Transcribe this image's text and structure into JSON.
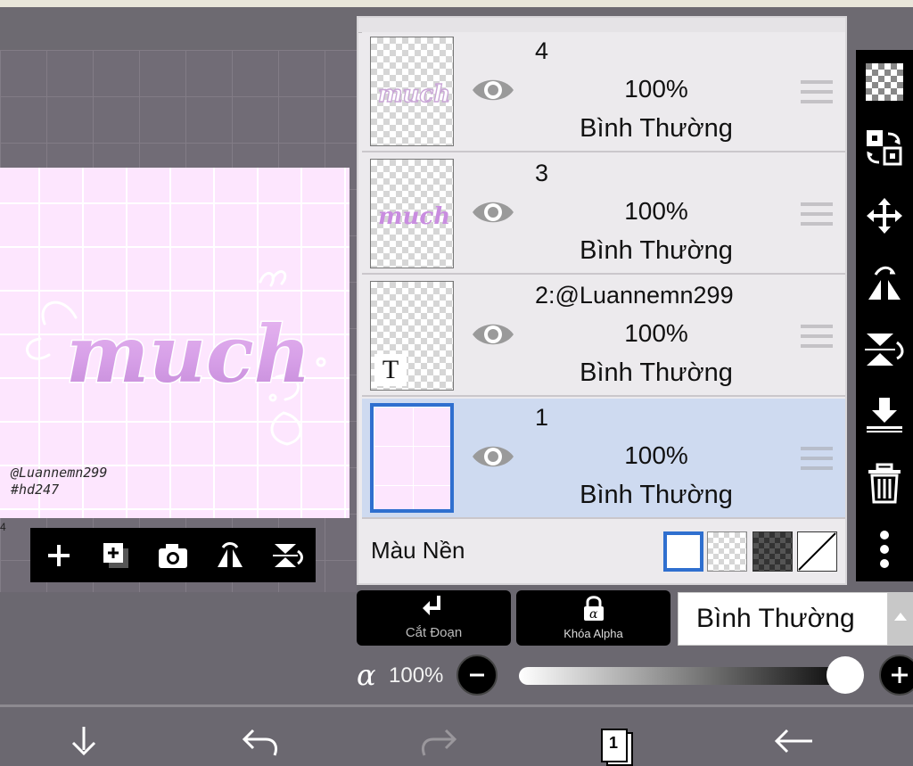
{
  "canvas": {
    "artwork_text": "much",
    "signature_line1": "@Luannemn299",
    "signature_line2": "#hd247",
    "left_mark": "4"
  },
  "layers": [
    {
      "name": "4",
      "opacity": "100%",
      "blend": "Bình Thường",
      "thumb_text": "much",
      "selected": false
    },
    {
      "name": "3",
      "opacity": "100%",
      "blend": "Bình Thường",
      "thumb_text": "much",
      "selected": false
    },
    {
      "name": "2:@Luannemn299",
      "opacity": "100%",
      "blend": "Bình Thường",
      "thumb_text": "T",
      "selected": false
    },
    {
      "name": "1",
      "opacity": "100%",
      "blend": "Bình Thường",
      "selected": true
    }
  ],
  "background_color": {
    "label": "Màu Nền"
  },
  "actions": {
    "clip_label": "Cắt Đoạn",
    "alpha_lock_label": "Khóa Alpha",
    "blend_mode": "Bình Thường"
  },
  "opacity": {
    "symbol": "α",
    "value_text": "100%",
    "level": 1.0
  },
  "bottom_bar": {
    "page_number": "1"
  },
  "colors": {
    "canvas_bg": "#fde6fe",
    "selected_layer": "#cedaf0",
    "selection_border": "#2f6fcf",
    "accent_purple": "#c98de0"
  }
}
